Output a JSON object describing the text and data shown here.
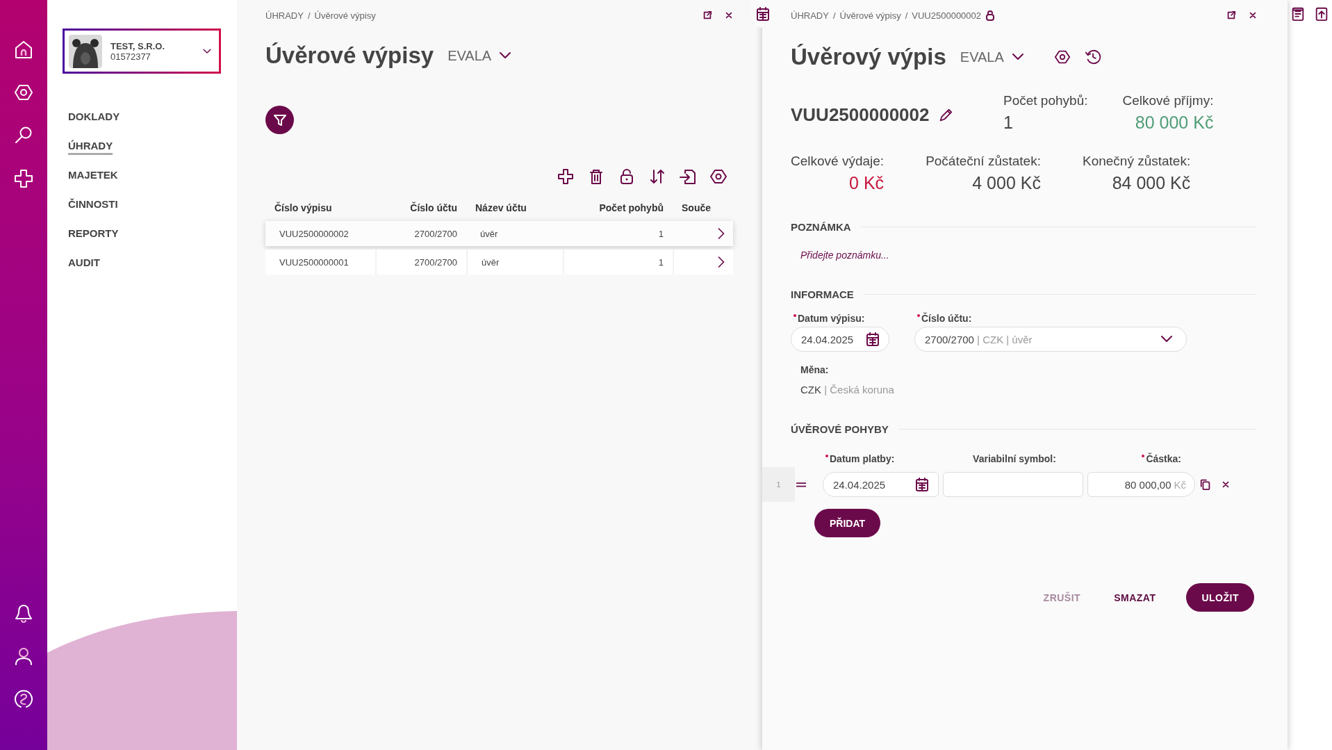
{
  "company": {
    "name": "TEST, S.R.O.",
    "id": "01572377"
  },
  "nav": [
    {
      "label": "DOKLADY",
      "selected": false
    },
    {
      "label": "ÚHRADY",
      "selected": true
    },
    {
      "label": "MAJETEK",
      "selected": false
    },
    {
      "label": "ČINNOSTI",
      "selected": false
    },
    {
      "label": "REPORTY",
      "selected": false
    },
    {
      "label": "AUDIT",
      "selected": false
    }
  ],
  "list_panel": {
    "breadcrumb": [
      "ÚHRADY",
      "Úvěrové výpisy"
    ],
    "separator": "/",
    "title": "Úvěrové výpisy",
    "agenda": "EVALA",
    "table": {
      "columns": [
        "Číslo výpisu",
        "Číslo účtu",
        "Název účtu",
        "Počet pohybů",
        "Souče"
      ],
      "rows": [
        {
          "selected": true,
          "cells": [
            "VUU2500000002",
            "2700/2700",
            "úvěr",
            "1"
          ]
        },
        {
          "selected": false,
          "cells": [
            "VUU2500000001",
            "2700/2700",
            "úvěr",
            "1"
          ]
        }
      ]
    }
  },
  "detail_panel": {
    "breadcrumb": [
      "ÚHRADY",
      "Úvěrové výpisy",
      "VUU2500000002"
    ],
    "separator": "/",
    "title": "Úvěrový výpis",
    "agenda": "EVALA",
    "document_number": "VUU2500000002",
    "stats": [
      {
        "label": "Počet pohybů:",
        "value": "1",
        "color": "#444444"
      },
      {
        "label": "Celkové příjmy:",
        "value": "80 000 Kč",
        "color": "#4f9d77"
      },
      {
        "label": "Celkové výdaje:",
        "value": "0 Kč",
        "color": "#c8153b"
      },
      {
        "label": "Počáteční zůstatek:",
        "value": "4 000 Kč",
        "color": "#444444"
      },
      {
        "label": "Konečný zůstatek:",
        "value": "84 000 Kč",
        "color": "#444444"
      }
    ],
    "note": {
      "heading": "POZNÁMKA",
      "placeholder": "Přidejte poznámku..."
    },
    "info": {
      "heading": "INFORMACE",
      "statement_date": {
        "label": "Datum výpisu:",
        "required": true,
        "value": "24.04.2025"
      },
      "account": {
        "label": "Číslo účtu:",
        "required": true,
        "value": "2700/2700",
        "secondary": "| CZK | úvěr"
      },
      "currency": {
        "label": "Měna:",
        "value": "CZK",
        "secondary": "| Česká koruna"
      }
    },
    "movements": {
      "heading": "ÚVĚROVÉ POHYBY",
      "columns": [
        {
          "label": "Datum platby:",
          "required": true
        },
        {
          "label": "Variabilní symbol:",
          "required": false
        },
        {
          "label": "Částka:",
          "required": true
        }
      ],
      "rows": [
        {
          "number": "1",
          "date": "24.04.2025",
          "amount": "80 000,00",
          "unit": "Kč"
        }
      ],
      "add_button": "PŘIDAT"
    },
    "actions": [
      {
        "label": "ZRUŠIT",
        "kind": "muted"
      },
      {
        "label": "SMAZAT",
        "kind": "text"
      },
      {
        "label": "ULOŽIT",
        "kind": "primary"
      }
    ]
  }
}
